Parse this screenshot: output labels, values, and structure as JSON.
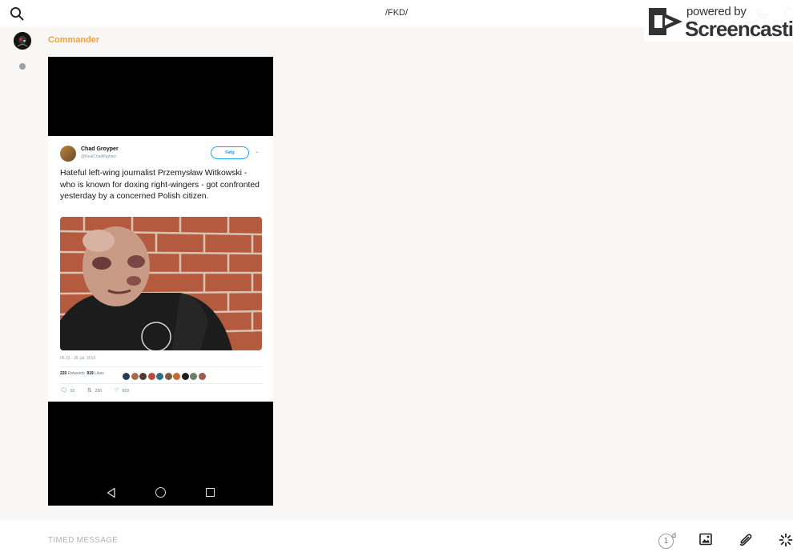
{
  "header": {
    "title": "/FKD/",
    "search_icon": "search-icon",
    "call_icon": "phone-icon",
    "info_icon": "info-icon"
  },
  "watermark": {
    "line1": "powered by",
    "line2": "Screencastify"
  },
  "conversation": {
    "sender": "Commander",
    "sender_color": "#f2a13d"
  },
  "tweet": {
    "author_name": "Chad Groyper",
    "author_handle": "@RealChadRighten",
    "follow_label": "Følg",
    "text": "Hateful left-wing journalist Przemysław Witkowski - who is known for doxing right-wingers - got confronted yesterday by a concerned Polish citizen.",
    "date": "05.31 - 26. jul. 2019",
    "retweets_count": "220",
    "retweets_label": "Retweets",
    "likes_count": "919",
    "likes_label": "Likes",
    "reply_count": "91",
    "retweet_count_action": "220",
    "like_count_action": "919",
    "accent_color": "#1da1f2"
  },
  "composer": {
    "placeholder": "TIMED MESSAGE",
    "timer_value": "1",
    "timer_unit": "d"
  }
}
